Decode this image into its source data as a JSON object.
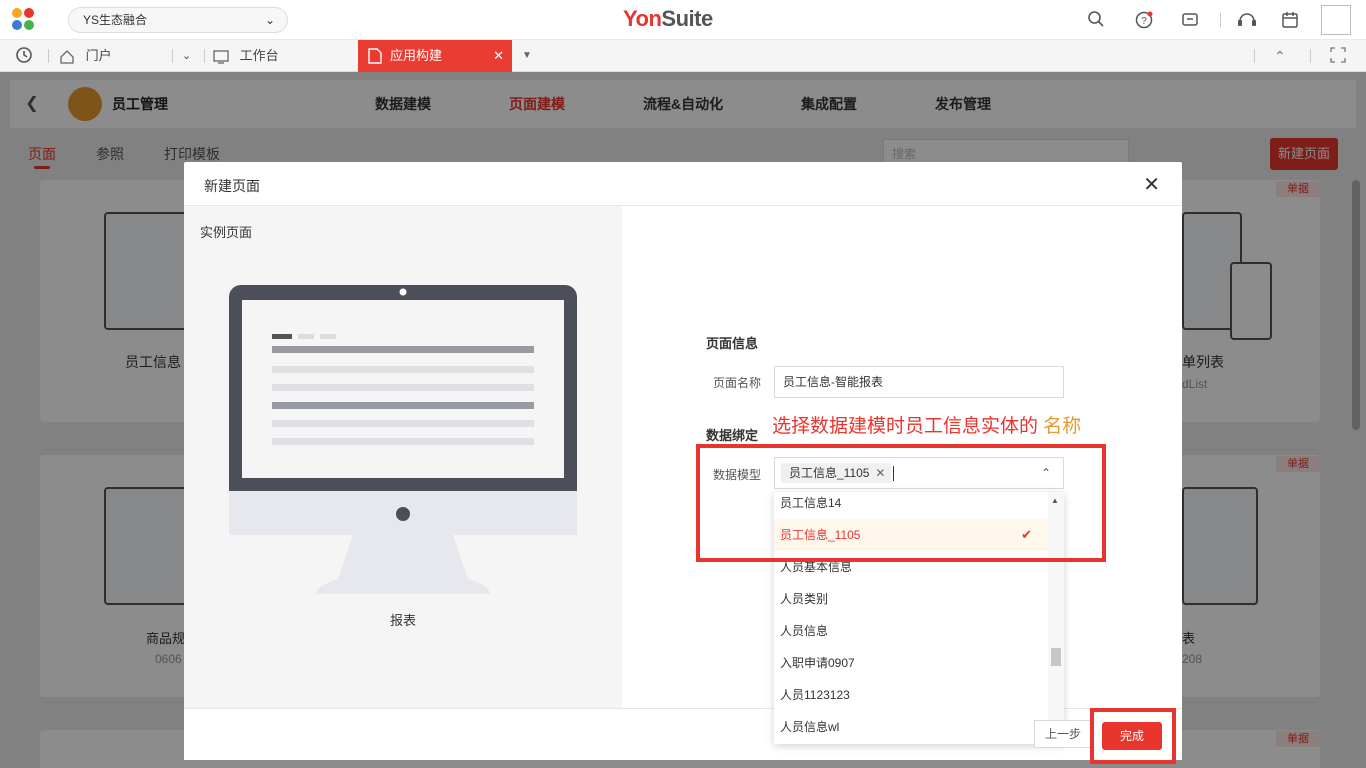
{
  "topbar": {
    "tenant": "YS生态融合",
    "brand_y": "Yon",
    "brand_s": "Suite"
  },
  "tabs": {
    "portal": "门户",
    "workbench": "工作台",
    "active": "应用构建"
  },
  "app": {
    "title": "员工管理",
    "nav": [
      "数据建模",
      "页面建模",
      "流程&自动化",
      "集成配置",
      "发布管理"
    ],
    "subnav": [
      "页面",
      "参照",
      "打印模板"
    ],
    "search_placeholder": "搜索",
    "new_page_button": "新建页面",
    "card_tag": "单据",
    "bg_texts": {
      "card1_title": "员工信息",
      "card2_title": "商品规",
      "card2_code": "0606",
      "card3_title": "单列表",
      "card3_code": "dList",
      "card4_title": "表",
      "card4_code": "208"
    }
  },
  "modal": {
    "title": "新建页面",
    "example_label": "实例页面",
    "report_label": "报表",
    "page_info_title": "页面信息",
    "page_name_label": "页面名称",
    "page_name_value": "员工信息-智能报表",
    "data_bind_title": "数据绑定",
    "data_model_label": "数据模型",
    "data_model_selected": "员工信息_1105",
    "annotation_main": "选择数据建模时员工信息实体的",
    "annotation_tail": "名称",
    "dropdown_items": [
      "员工信息14",
      "员工信息_1105",
      "人员基本信息",
      "人员类别",
      "人员信息",
      "入职申请0907",
      "人员1123123",
      "人员信息wl"
    ],
    "prev_button": "上一步",
    "done_button": "完成"
  }
}
